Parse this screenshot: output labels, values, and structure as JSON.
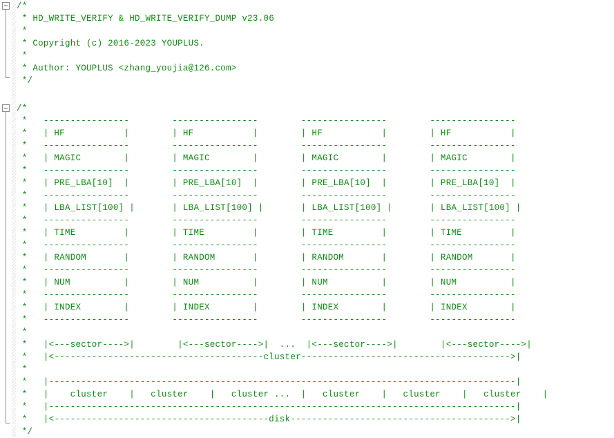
{
  "editor": {
    "language": "c",
    "background_color": "#ffffff",
    "comment_color": "#0f8a12",
    "gutter_color": "#8c8c8c",
    "font_size_px": 12.5,
    "line_height_px": 18
  },
  "gutter": {
    "fold_markers": [
      {
        "name": "fold-marker-header-comment",
        "state": "expanded",
        "glyph": "minus"
      },
      {
        "name": "fold-marker-diagram-comment",
        "state": "expanded",
        "glyph": "minus"
      }
    ]
  },
  "blocks": {
    "header_comment": {
      "name": "header-comment-block",
      "lines": [
        "/*",
        " * HD_WRITE_VERIFY & HD_WRITE_VERIFY_DUMP v23.06",
        " *",
        " * Copyright (c) 2016-2023 YOUPLUS.",
        " *",
        " * Author: YOUPLUS <zhang_youjia@126.com>",
        " */"
      ],
      "title": "HD_WRITE_VERIFY & HD_WRITE_VERIFY_DUMP v23.06",
      "version": "v23.06",
      "copyright": "Copyright (c) 2016-2023 YOUPLUS.",
      "author": "Author: YOUPLUS <zhang_youjia@126.com>",
      "author_name": "YOUPLUS",
      "author_email": "zhang_youjia@126.com",
      "years": "2016-2023"
    },
    "diagram_comment": {
      "name": "diagram-comment-block",
      "lines": [
        "/*",
        " *    ----------------        ----------------        ----------------        ----------------",
        " *    | HF           |        | HF           |        | HF           |        | HF           |",
        " *    ----------------        ----------------        ----------------        ----------------",
        " *    | MAGIC        |        | MAGIC        |        | MAGIC        |        | MAGIC        |",
        " *    ----------------        ----------------        ----------------        ----------------",
        " *    | PRE_LBA[10]  |        | PRE_LBA[10]  |        | PRE_LBA[10]  |        | PRE_LBA[10]  |",
        " *    ----------------        ----------------        ----------------        ----------------",
        " *    | LBA_LIST[100] |       | LBA_LIST[100] |       | LBA_LIST[100] |       | LBA_LIST[100] |",
        " *    ----------------        ----------------        ----------------        ----------------",
        " *    | TIME         |        | TIME         |        | TIME         |        | TIME         |",
        " *    ----------------        ----------------        ----------------        ----------------",
        " *    | RANDOM       |        | RANDOM       |        | RANDOM       |        | RANDOM       |",
        " *    ----------------        ----------------        ----------------        ----------------",
        " *    | NUM          |        | NUM          |        | NUM          |        | NUM          |",
        " *    ----------------        ----------------        ----------------        ----------------",
        " *    | INDEX        |        | INDEX        |        | INDEX        |        | INDEX        |",
        " *    ----------------        ----------------        ----------------        ----------------",
        " *",
        " *    |<---sector---->|       |<---sector---->|  ...  |<---sector---->|       |<---sector---->|",
        " *    |<--------------------------------------cluster-------------------------------------->|",
        " *",
        " *    |--------------------------------------------------------------------------------------|",
        " *    |    cluster    |    cluster    |    cluster ...  |    cluster    |    cluster    |    cluster    |",
        " *    |--------------------------------------------------------------------------------------|",
        " *    |<----------------------------------------disk---------------------------------------->|",
        " */"
      ],
      "struct_fields": [
        "HF",
        "MAGIC",
        "PRE_LBA[10]",
        "LBA_LIST[100]",
        "TIME",
        "RANDOM",
        "NUM",
        "INDEX"
      ],
      "sector_label": "sector",
      "cluster_label": "cluster",
      "disk_label": "disk",
      "ellipsis": "...",
      "sector_columns": 4,
      "cluster_cells": 6
    }
  },
  "ascii": {
    "header": [
      "/*",
      " * HD_WRITE_VERIFY & HD_WRITE_VERIFY_DUMP v23.06",
      " *",
      " * Copyright (c) 2016-2023 YOUPLUS.",
      " *",
      " * Author: YOUPLUS <zhang_youjia@126.com>",
      " */"
    ],
    "diagram": [
      "/*",
      " *   ----------------        ----------------        ----------------        ----------------",
      " *   | HF           |        | HF           |        | HF           |        | HF           |",
      " *   ----------------        ----------------        ----------------        ----------------",
      " *   | MAGIC        |        | MAGIC        |        | MAGIC        |        | MAGIC        |",
      " *   ----------------        ----------------        ----------------        ----------------",
      " *   | PRE_LBA[10]  |        | PRE_LBA[10]  |        | PRE_LBA[10]  |        | PRE_LBA[10]  |",
      " *   ----------------        ----------------        ----------------        ----------------",
      " *   | LBA_LIST[100] |       | LBA_LIST[100] |       | LBA_LIST[100] |       | LBA_LIST[100] |",
      " *   ----------------        ----------------        ----------------        ----------------",
      " *   | TIME         |        | TIME         |        | TIME         |        | TIME         |",
      " *   ----------------        ----------------        ----------------        ----------------",
      " *   | RANDOM       |        | RANDOM       |        | RANDOM       |        | RANDOM       |",
      " *   ----------------        ----------------        ----------------        ----------------",
      " *   | NUM          |        | NUM          |        | NUM          |        | NUM          |",
      " *   ----------------        ----------------        ----------------        ----------------",
      " *   | INDEX        |        | INDEX        |        | INDEX        |        | INDEX        |",
      " *   ----------------        ----------------        ----------------        ----------------",
      " *",
      " *   |<---sector---->|        |<---sector---->|  ...  |<---sector---->|        |<---sector---->|",
      " *   |<---------------------------------------cluster--------------------------------------->|",
      " *",
      " *   |---------------------------------------------------------------------------------------|",
      " *   |    cluster    |   cluster    |   cluster ...  |   cluster    |   cluster    |   cluster    |",
      " *   |---------------------------------------------------------------------------------------|",
      " *   |<----------------------------------------disk----------------------------------------->|",
      " */"
    ]
  }
}
